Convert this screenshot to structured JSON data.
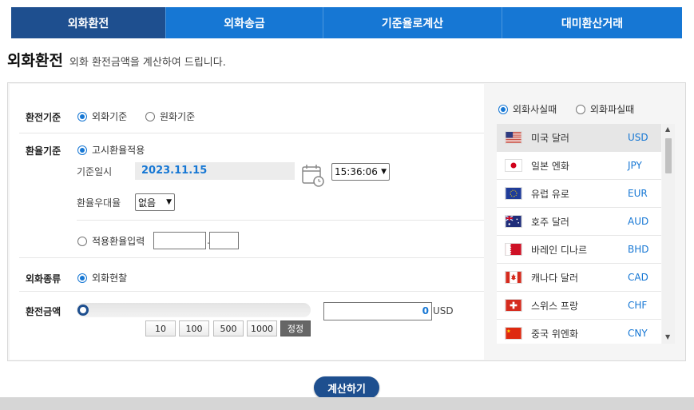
{
  "tabs": [
    {
      "label": "외화환전"
    },
    {
      "label": "외화송금"
    },
    {
      "label": "기준율로계산"
    },
    {
      "label": "대미환산거래"
    }
  ],
  "heading": {
    "title": "외화환전",
    "subtitle": "외화 환전금액을 계산하여 드립니다."
  },
  "form": {
    "exchange_basis": {
      "label": "환전기준",
      "options": [
        "외화기준",
        "원화기준"
      ]
    },
    "rate_basis": {
      "label": "환율기준",
      "option_notice": "고시환율적용",
      "date_label": "기준일시",
      "date_value": "2023.11.15",
      "time_value": "15:36:06",
      "preferential_label": "환율우대율",
      "preferential_value": "없음",
      "manual_option": "적용환율입력"
    },
    "currency_kind": {
      "label": "외화종류",
      "option": "외화현찰"
    },
    "amount": {
      "label": "환전금액",
      "value": "0",
      "unit": "USD",
      "slider_fraction": 0,
      "quick": [
        "10",
        "100",
        "500",
        "1000",
        "정정"
      ]
    }
  },
  "right_panel": {
    "options": [
      "외화사실때",
      "외화파실때"
    ],
    "currencies": [
      {
        "name": "미국 달러",
        "code": "USD"
      },
      {
        "name": "일본 엔화",
        "code": "JPY"
      },
      {
        "name": "유럽 유로",
        "code": "EUR"
      },
      {
        "name": "호주 달러",
        "code": "AUD"
      },
      {
        "name": "바레인 디나르",
        "code": "BHD"
      },
      {
        "name": "캐나다 달러",
        "code": "CAD"
      },
      {
        "name": "스위스 프랑",
        "code": "CHF"
      },
      {
        "name": "중국 위엔화",
        "code": "CNY"
      }
    ]
  },
  "calculate_button": "계산하기",
  "colors": {
    "tab_active": "#1e4f8f",
    "tab": "#1677d4",
    "accent": "#1677d4"
  }
}
